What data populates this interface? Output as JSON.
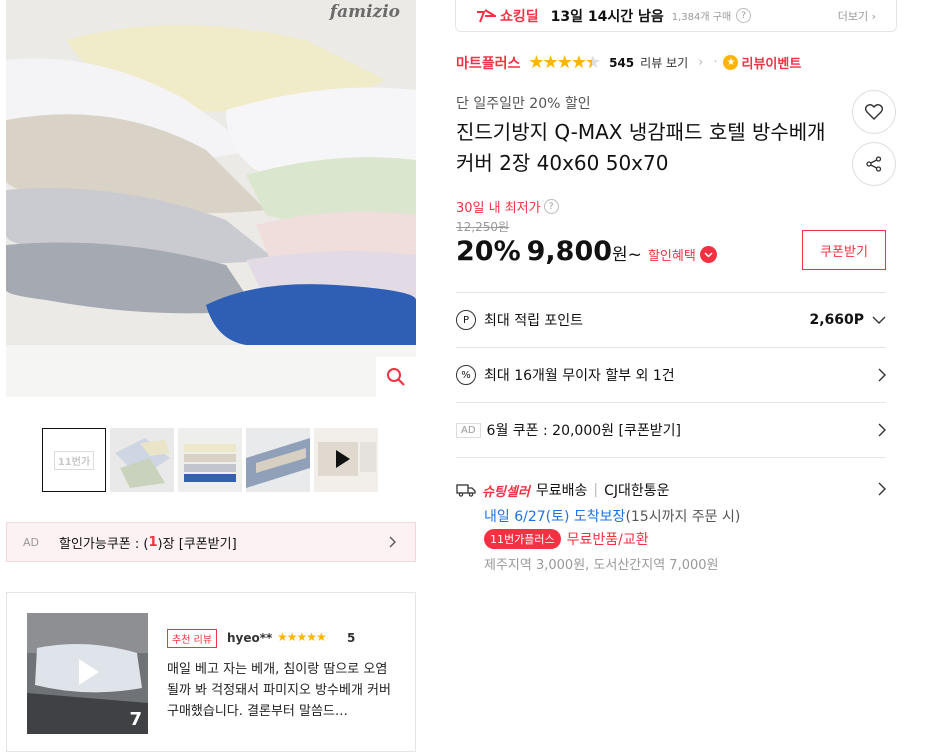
{
  "gallery": {
    "brand_watermark": "famizio",
    "zoom_icon": "magnifier-icon",
    "thumbnail_logo": "11번가",
    "thumbnails": [
      "thumb-1",
      "thumb-2",
      "thumb-3",
      "thumb-4",
      "thumb-5-video"
    ]
  },
  "coupon_bar": {
    "ad": "AD",
    "text_before": "할인가능쿠폰 : (",
    "count": "1",
    "text_after": ")장 [쿠폰받기]"
  },
  "review": {
    "badge": "추천 리뷰",
    "reviewer": "hyeo**",
    "stars": "★★★★★",
    "score": "5",
    "media_count": "7",
    "text": "매일 베고 자는 베개, 침이랑 땀으로 오염될까 봐 걱정돼서 파미지오 방수베개 커버 구매했습니다. 결론부터 말씀드…"
  },
  "shocking_deal": {
    "logo": "쇼킹딜",
    "timer": "13일 14시간 남음",
    "bought": "1,384개 구매",
    "more": "더보기 ›"
  },
  "seller": {
    "name": "마트플러스",
    "rating": 4.5,
    "review_count": "545",
    "review_label": "리뷰 보기",
    "review_event": "리뷰이벤트"
  },
  "product": {
    "promo": "단 일주일만 20% 할인",
    "title": "진드기방지 Q-MAX 냉감패드 호텔 방수베개커버 2장 40x60 50x70",
    "lowest_label": "30일 내 최저가",
    "original_price": "12,250원",
    "discount": "20%",
    "price": "9,800",
    "won": "원~",
    "benefit": "할인혜택",
    "coupon_button": "쿠폰받기"
  },
  "info_rows": {
    "points_label": "최대 적립 포인트",
    "points_value": "2,660P",
    "installment": "최대 16개월 무이자 할부 외 1건",
    "ad_tag": "AD",
    "june_coupon": "6월 쿠폰 : 20,000원 [쿠폰받기]"
  },
  "shipping": {
    "seller_tag": "슈팅셀러",
    "free": "무료배송",
    "carrier": "CJ대한통운",
    "arrival": "내일 6/27(토) 도착보장",
    "arrival_sub": "(15시까지 주문 시)",
    "plus_badge": "11번가플러스",
    "returns": "무료반품/교환",
    "extra_fee": "제주지역 3,000원, 도서산간지역 7,000원"
  },
  "colors": {
    "accent": "#f43142",
    "star": "#ffb400",
    "link": "#1a73e8"
  }
}
